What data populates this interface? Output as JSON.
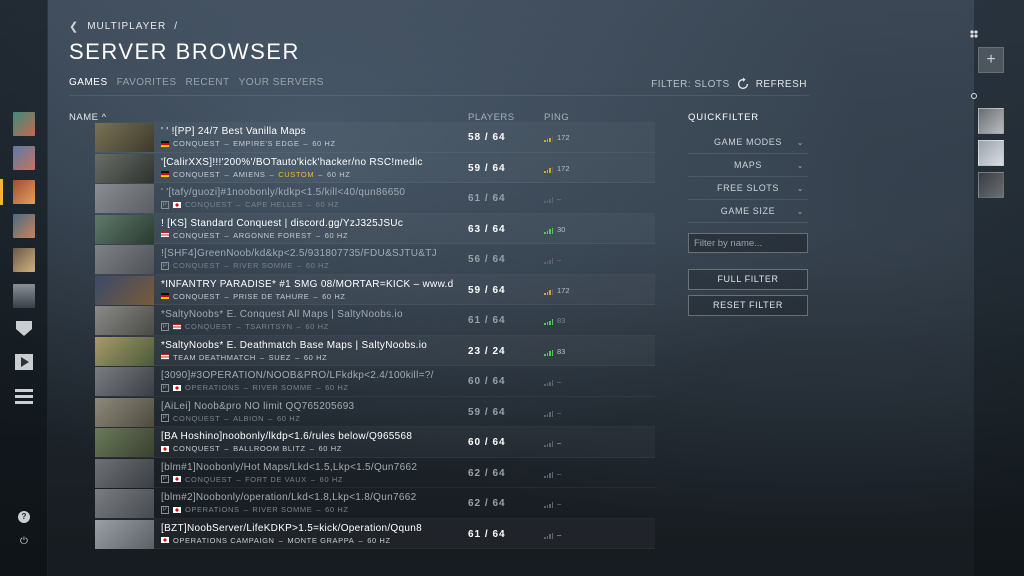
{
  "breadcrumb": {
    "back_icon": "chevron-left-icon",
    "parent": "MULTIPLAYER",
    "separator": "/"
  },
  "page": {
    "title": "SERVER BROWSER"
  },
  "tabs": [
    "GAMES",
    "FAVORITES",
    "RECENT",
    "YOUR SERVERS"
  ],
  "filter": {
    "label": "FILTER: SLOTS",
    "refresh_label": "REFRESH",
    "refresh_icon": "refresh-icon"
  },
  "columns": {
    "name": "NAME ^",
    "players": "PLAYERS",
    "ping": "PING"
  },
  "servers": [
    {
      "name": "' ' ![PP] 24/7 Best Vanilla Maps",
      "mode": "CONQUEST",
      "map": "EMPIRE'S EDGE",
      "hz": "60 HZ",
      "extra": "",
      "players": "58 / 64",
      "ping": "172",
      "region": "de",
      "style": "bright",
      "bars": 3,
      "password": false
    },
    {
      "name": "'[CalirXXS]!!!'200%'/BOTauto'kick'hacker/no RSC!medic",
      "mode": "CONQUEST",
      "map": "AMIENS",
      "hz": "60 HZ",
      "extra": "CUSTOM",
      "players": "59 / 64",
      "ping": "172",
      "region": "de",
      "style": "bright",
      "bars": 3,
      "password": false
    },
    {
      "name": "' '[tafy/guozi]#1noobonly/kdkp<1.5/kill<40/qun86650",
      "mode": "CONQUEST",
      "map": "CAPE HELLES",
      "hz": "60 HZ",
      "extra": "",
      "players": "61 / 64",
      "ping": "–",
      "region": "jp",
      "style": "dim",
      "bars": 0,
      "password": true
    },
    {
      "name": "! [KS] Standard Conquest | discord.gg/YzJ325JSUc",
      "mode": "CONQUEST",
      "map": "ARGONNE FOREST",
      "hz": "60 HZ",
      "extra": "",
      "players": "63 / 64",
      "ping": "30",
      "region": "us",
      "style": "bright",
      "bars": 4,
      "password": false
    },
    {
      "name": "![SHF4]GreenNoob/kd&kp<2.5/931807735/FDU&SJTU&TJ",
      "mode": "CONQUEST",
      "map": "RIVER SOMME",
      "hz": "60 HZ",
      "extra": "",
      "players": "56 / 64",
      "ping": "–",
      "region": "none",
      "style": "dim",
      "bars": 0,
      "password": true
    },
    {
      "name": "*INFANTRY PARADISE* #1 SMG 08/MORTAR=KICK – www.d",
      "mode": "CONQUEST",
      "map": "PRISE DE TAHURE",
      "hz": "60 HZ",
      "extra": "",
      "players": "59 / 64",
      "ping": "172",
      "region": "de",
      "style": "bright",
      "bars": 3,
      "password": false
    },
    {
      "name": "*SaltyNoobs* E. Conquest All Maps | SaltyNoobs.io",
      "mode": "CONQUEST",
      "map": "TSARITSYN",
      "hz": "60 HZ",
      "extra": "",
      "players": "61 / 64",
      "ping": "83",
      "region": "us",
      "style": "dim",
      "bars": 4,
      "password": true
    },
    {
      "name": "*SaltyNoobs* E. Deathmatch Base Maps | SaltyNoobs.io",
      "mode": "TEAM DEATHMATCH",
      "map": "SUEZ",
      "hz": "60 HZ",
      "extra": "",
      "players": "23 / 24",
      "ping": "83",
      "region": "us",
      "style": "bright",
      "bars": 4,
      "password": false
    },
    {
      "name": "[3090]#3OPERATION/NOOB&PRO/LFkdkp<2.4/100kill=?/",
      "mode": "OPERATIONS",
      "map": "RIVER SOMME",
      "hz": "60 HZ",
      "extra": "",
      "players": "60 / 64",
      "ping": "–",
      "region": "jp",
      "style": "dim",
      "bars": 0,
      "password": true
    },
    {
      "name": "[AiLei] Noob&pro NO limit QQ765205693",
      "mode": "CONQUEST",
      "map": "ALBION",
      "hz": "60 HZ",
      "extra": "",
      "players": "59 / 64",
      "ping": "–",
      "region": "none",
      "style": "dim",
      "bars": 0,
      "password": true
    },
    {
      "name": "[BA Hoshino]noobonly/lkdp<1.6/rules below/Q965568",
      "mode": "CONQUEST",
      "map": "BALLROOM BLITZ",
      "hz": "60 HZ",
      "extra": "",
      "players": "60 / 64",
      "ping": "–",
      "region": "jp",
      "style": "bright",
      "bars": 0,
      "password": false
    },
    {
      "name": "[blm#1]Noobonly/Hot Maps/Lkd<1.5,Lkp<1.5/Qun7662",
      "mode": "CONQUEST",
      "map": "FORT DE VAUX",
      "hz": "60 HZ",
      "extra": "",
      "players": "62 / 64",
      "ping": "–",
      "region": "jp",
      "style": "dim",
      "bars": 0,
      "password": true
    },
    {
      "name": "[blm#2]Noobonly/operation/Lkd<1.8,Lkp<1.8/Qun7662",
      "mode": "OPERATIONS",
      "map": "RIVER SOMME",
      "hz": "60 HZ",
      "extra": "",
      "players": "62 / 64",
      "ping": "–",
      "region": "jp",
      "style": "dim",
      "bars": 0,
      "password": true
    },
    {
      "name": "[BZT]NoobServer/LifeKDKP>1.5=kick/Operation/Qqun8",
      "mode": "OPERATIONS CAMPAIGN",
      "map": "MONTE GRAPPA",
      "hz": "60 HZ",
      "extra": "",
      "players": "61 / 64",
      "ping": "–",
      "region": "jp",
      "style": "bright",
      "bars": 0,
      "password": false
    }
  ],
  "quickfilter": {
    "title": "QUICKFILTER",
    "dropdowns": [
      "GAME MODES",
      "MAPS",
      "FREE SLOTS",
      "GAME SIZE"
    ],
    "search_placeholder": "Filter by name...",
    "full_filter": "FULL FILTER",
    "reset_filter": "RESET FILTER"
  },
  "right_rail": {
    "add_label": "+"
  },
  "left_rail": {
    "help_label": "?",
    "power_label": "⏻"
  },
  "colors": {
    "accent": "#f2b731",
    "ping_good": "#4ccf4c",
    "ping_mid": "#e0a030"
  }
}
